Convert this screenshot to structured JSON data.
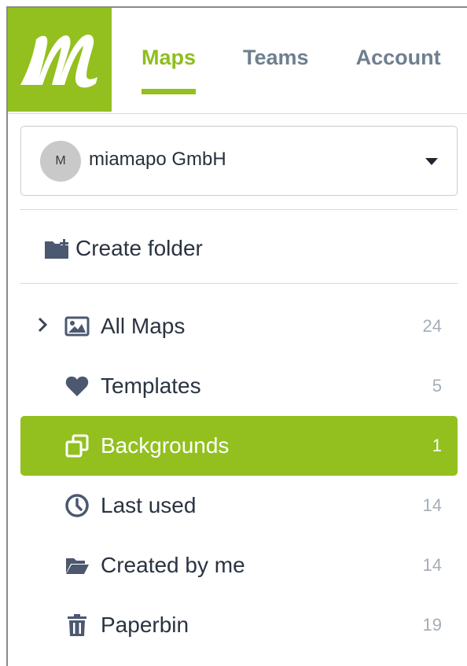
{
  "colors": {
    "brand": "#93c01f",
    "tab_active": "#8fbd1e",
    "tab_inactive": "#6f7f8f",
    "count": "#a4adb8",
    "icon": "#4c5870"
  },
  "tabs": [
    {
      "label": "Maps",
      "active": true
    },
    {
      "label": "Teams",
      "active": false
    },
    {
      "label": "Account",
      "active": false
    }
  ],
  "organization": {
    "avatar_initial": "M",
    "name": "miamapo GmbH",
    "icon": "chevron-down-icon"
  },
  "create_folder": {
    "label": "Create folder",
    "icon": "folder-plus-icon"
  },
  "nav": [
    {
      "label": "All Maps",
      "count": "24",
      "icon": "image-icon",
      "expandable": true
    },
    {
      "label": "Templates",
      "count": "5",
      "icon": "heart-icon"
    },
    {
      "label": "Backgrounds",
      "count": "1",
      "icon": "layers-icon",
      "active": true
    },
    {
      "label": "Last used",
      "count": "14",
      "icon": "clock-icon"
    },
    {
      "label": "Created by me",
      "count": "14",
      "icon": "folder-open-icon"
    },
    {
      "label": "Paperbin",
      "count": "19",
      "icon": "trash-icon"
    }
  ]
}
